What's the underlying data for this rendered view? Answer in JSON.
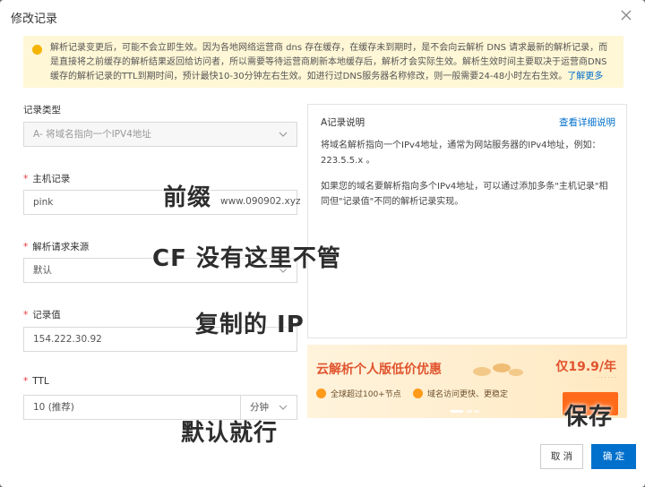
{
  "dialog": {
    "title": "修改记录",
    "close_icon": "close-icon"
  },
  "notice": {
    "text": "解析记录变更后，可能不会立即生效。因为各地网络运营商 dns 存在缓存，在缓存未到期时，是不会向云解析 DNS 请求最新的解析记录，而是直接将之前缓存的解析结果返回给访问者，所以需要等待运营商刷新本地缓存后，解析才会实际生效。解析生效时间主要取决于运营商DNS缓存的解析记录的TTL到期时间，预计最快10-30分钟左右生效。如进行过DNS服务器名称修改，则一般需要24-48小时左右生效。",
    "link": "了解更多"
  },
  "form": {
    "record_type": {
      "label": "记录类型",
      "value": "A- 将域名指向一个IPV4地址"
    },
    "host": {
      "label": "主机记录",
      "value": "pink",
      "suffix": "www.090902.xyz"
    },
    "line": {
      "label": "解析请求来源",
      "value": "默认"
    },
    "value": {
      "label": "记录值",
      "value": "154.222.30.92"
    },
    "ttl": {
      "label": "TTL",
      "value": "10 (推荐)",
      "unit": "分钟"
    }
  },
  "panel": {
    "title": "A记录说明",
    "link": "查看详细说明",
    "p1": "将域名解析指向一个IPv4地址，通常为网站服务器的IPv4地址，例如：223.5.5.x 。",
    "p2": "如果您的域名要解析指向多个IPv4地址，可以通过添加多条\"主机记录\"相同但\"记录值\"不同的解析记录实现。"
  },
  "banner": {
    "title": "云解析个人版低价优惠",
    "price": "仅19.9/年",
    "feature1": "全球超过100+节点",
    "feature2": "域名访问更快、更稳定"
  },
  "buttons": {
    "cancel": "取 消",
    "ok": "确 定"
  },
  "annotations": {
    "prefix": "前缀",
    "cf": "CF 没有这里不管",
    "copy_ip": "复制的 IP",
    "default_ok": "默认就行",
    "save": "保存"
  },
  "colors": {
    "primary": "#0070cc",
    "required": "#e4393c",
    "notice_bg": "#fff7d6",
    "promo": "#e0542e"
  }
}
